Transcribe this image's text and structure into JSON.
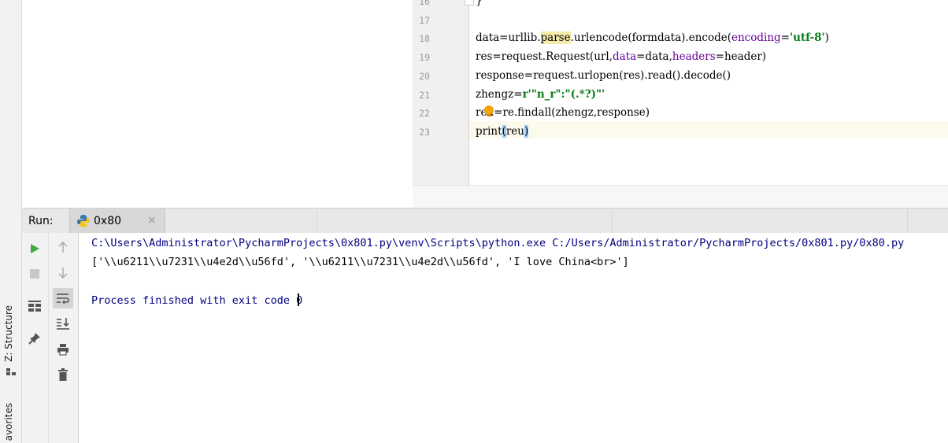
{
  "left_strip": {
    "structure_label": "Z: Structure",
    "favorites_label": "avorites"
  },
  "editor": {
    "lines": [
      {
        "num": "16",
        "parts": [
          {
            "t": "}",
            "c": ""
          }
        ]
      },
      {
        "num": "17",
        "parts": []
      },
      {
        "num": "18",
        "parts": [
          {
            "t": "data=urllib.",
            "c": ""
          },
          {
            "t": "parse",
            "c": "hl-parse"
          },
          {
            "t": ".urlencode(formdata).encode(",
            "c": ""
          },
          {
            "t": "encoding",
            "c": "kw-param"
          },
          {
            "t": "=",
            "c": ""
          },
          {
            "t": "'utf-8'",
            "c": "str"
          },
          {
            "t": ")",
            "c": ""
          }
        ]
      },
      {
        "num": "19",
        "parts": [
          {
            "t": "res=request.Request(url,",
            "c": ""
          },
          {
            "t": "data",
            "c": "kw-param"
          },
          {
            "t": "=data,",
            "c": ""
          },
          {
            "t": "headers",
            "c": "kw-param"
          },
          {
            "t": "=header)",
            "c": ""
          }
        ]
      },
      {
        "num": "20",
        "parts": [
          {
            "t": "response=request.urlopen(res).read().decode()",
            "c": ""
          }
        ]
      },
      {
        "num": "21",
        "parts": [
          {
            "t": "zhengz=",
            "c": ""
          },
          {
            "t": "r'\"n_r\":\"(.*?)\"'",
            "c": "str"
          }
        ]
      },
      {
        "num": "22",
        "parts": [
          {
            "t": "reu=re.findall(zhengz,response)",
            "c": ""
          }
        ]
      },
      {
        "num": "23",
        "parts": [
          {
            "t": "print",
            "c": ""
          },
          {
            "t": "(",
            "c": "brace-hl"
          },
          {
            "t": "reu",
            "c": ""
          },
          {
            "t": ")",
            "c": "brace-hl"
          }
        ]
      }
    ]
  },
  "run": {
    "label": "Run:",
    "tab_title": "0x80",
    "close_glyph": "×"
  },
  "console": {
    "command": "C:\\Users\\Administrator\\PycharmProjects\\0x801.py\\venv\\Scripts\\python.exe C:/Users/Administrator/PycharmProjects/0x801.py/0x80.py",
    "output": "['\\\\u6211\\\\u7231\\\\u4e2d\\\\u56fd', '\\\\u6211\\\\u7231\\\\u4e2d\\\\u56fd', 'I love China<br>']",
    "process": "Process finished with exit code 0"
  },
  "colors": {
    "play": "#3eaa45",
    "stop": "#c8c8c8",
    "console_blue": "#000080",
    "string_green": "#067d17",
    "param_purple": "#660099",
    "bulb": "#f0a30a"
  },
  "icons": [
    "python-icon",
    "play-icon",
    "stop-icon",
    "up-arrow-icon",
    "down-arrow-icon",
    "layout-icon",
    "pin-icon",
    "soft-wrap-icon",
    "scroll-to-end-icon",
    "print-icon",
    "trash-icon",
    "intention-bulb-icon"
  ]
}
